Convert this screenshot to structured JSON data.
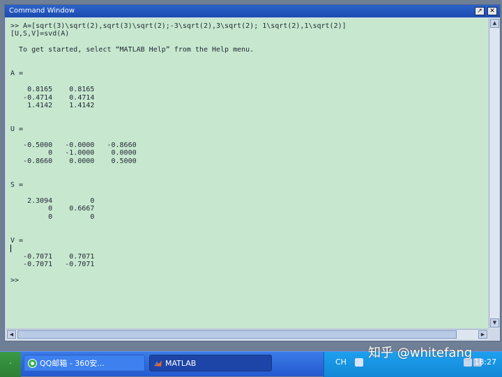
{
  "window": {
    "title": "Command Window",
    "dock_glyph": "↗",
    "close_glyph": "✕"
  },
  "console_lines": [
    ">> A=[sqrt(3)\\sqrt(2),sqrt(3)\\sqrt(2);-3\\sqrt(2),3\\sqrt(2); 1\\sqrt(2),1\\sqrt(2)]",
    "[U,S,V]=svd(A)",
    "",
    "  To get started, select “MATLAB Help” from the Help menu.",
    "",
    "",
    "A =",
    "",
    "    0.8165    0.8165",
    "   -0.4714    0.4714",
    "    1.4142    1.4142",
    "",
    "",
    "U =",
    "",
    "   -0.5000   -0.0000   -0.8660",
    "         0   -1.0000    0.0000",
    "   -0.8660    0.0000    0.5000",
    "",
    "",
    "S =",
    "",
    "    2.3094         0",
    "         0    0.6667",
    "         0         0",
    "",
    "",
    "V =",
    "",
    "   -0.7071    0.7071",
    "   -0.7071   -0.7071",
    "",
    ">>"
  ],
  "scroll_glyphs": {
    "up": "▲",
    "down": "▼",
    "left": "◀",
    "right": "▶"
  },
  "taskbar": {
    "start": ".",
    "tasks": [
      {
        "label": "QQ邮箱 - 360安...",
        "icon": "qq-mail-icon"
      },
      {
        "label": "MATLAB",
        "icon": "matlab-icon"
      }
    ],
    "ime": "CH",
    "clock": "18:27"
  },
  "watermark": "知乎 @whitefang",
  "colors": {
    "console_bg": "#c7e8cf",
    "title_bar": "#1c4bb0",
    "taskbar": "#2459cf",
    "tray": "#1287d6"
  }
}
